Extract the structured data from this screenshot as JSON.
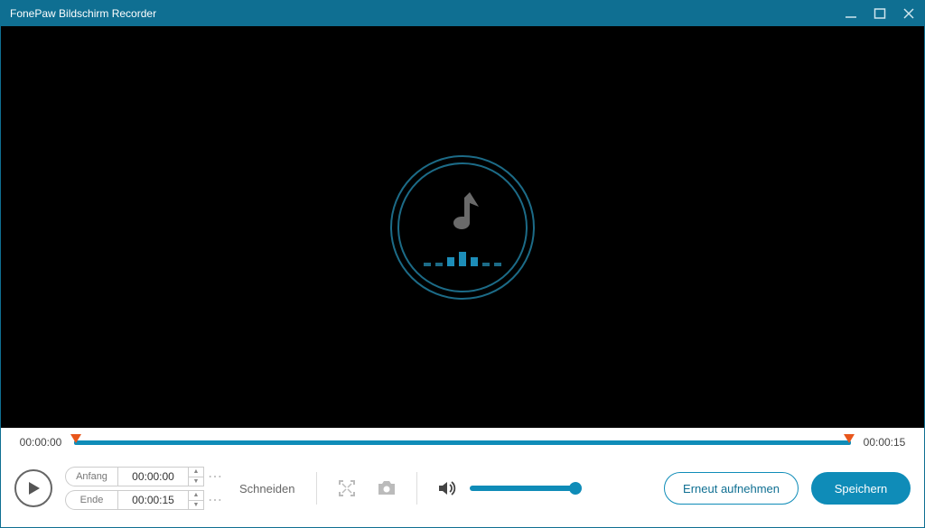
{
  "window": {
    "title": "FonePaw Bildschirm Recorder"
  },
  "timeline": {
    "start": "00:00:00",
    "end": "00:00:15"
  },
  "trim": {
    "start_label": "Anfang",
    "end_label": "Ende",
    "start_time": "00:00:00",
    "end_time": "00:00:15",
    "cut_label": "Schneiden"
  },
  "buttons": {
    "rerecord": "Erneut aufnehmen",
    "save": "Speichern"
  }
}
